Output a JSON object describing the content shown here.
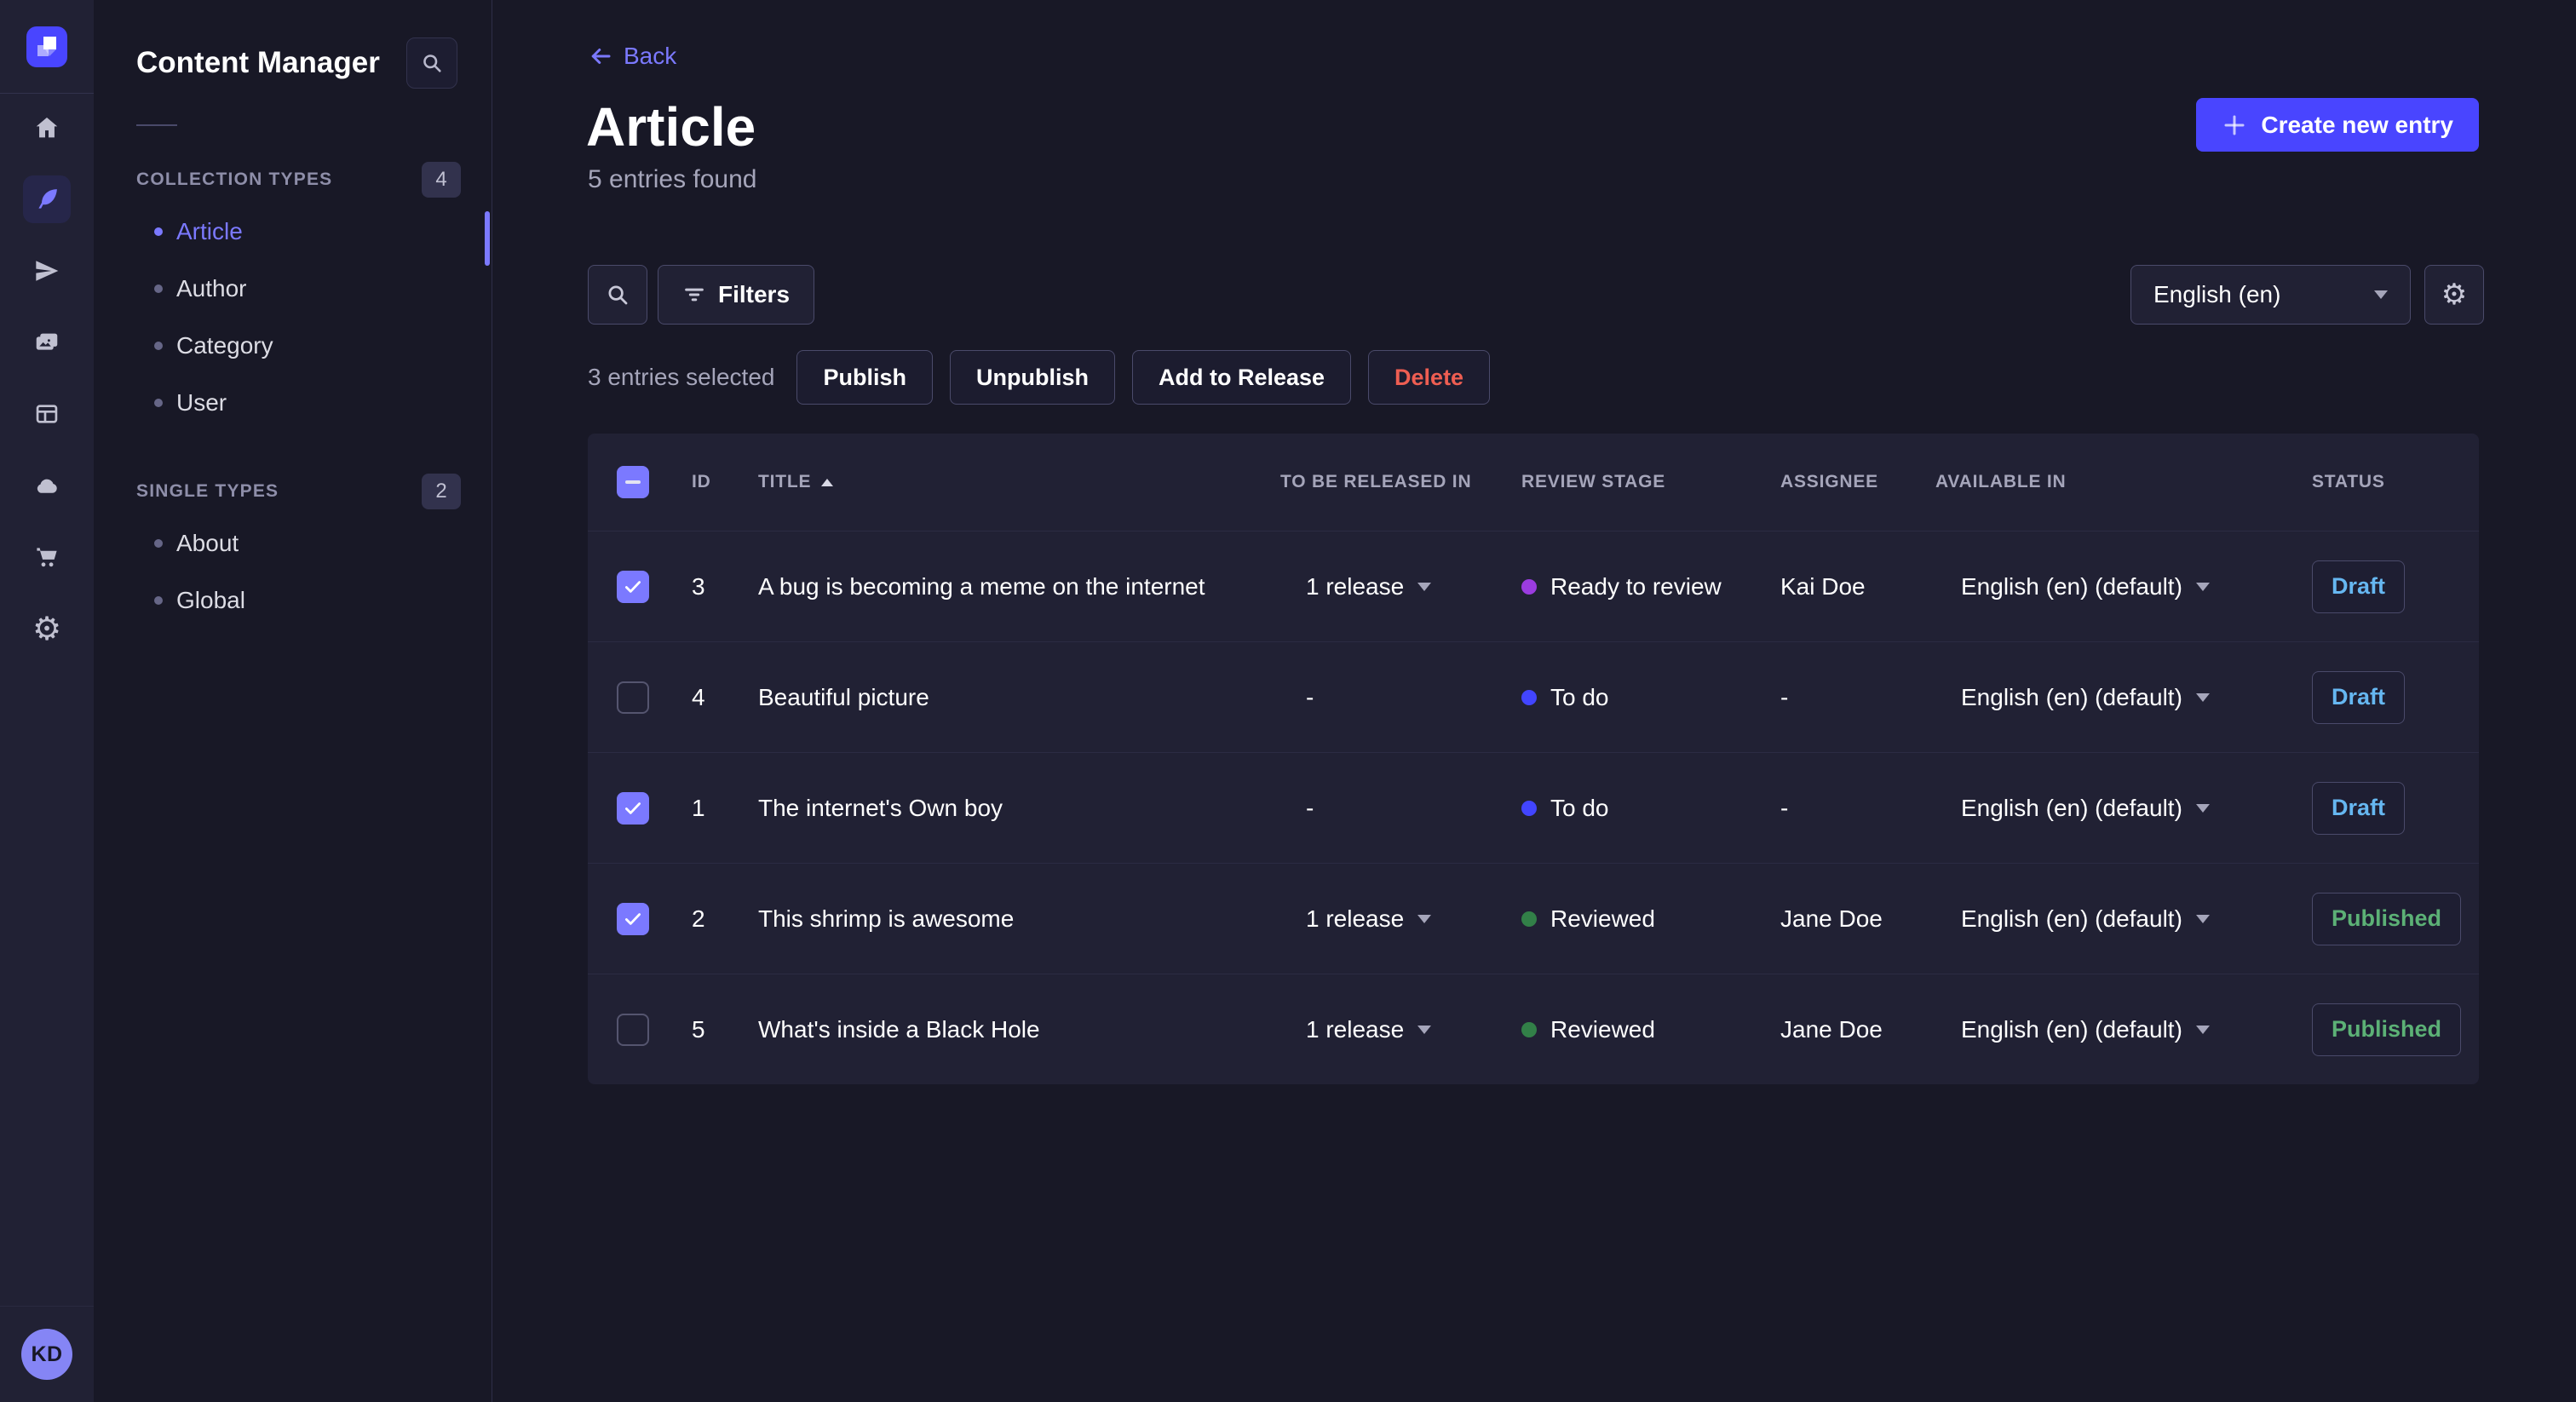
{
  "colors": {
    "accent": "#4945ff",
    "accent_light": "#7b79ff",
    "draft": "#66b7f1",
    "published": "#5cb176",
    "danger": "#ee5e52",
    "stage_todo": "#4245ff",
    "stage_ready": "#9b3ce0",
    "stage_reviewed": "#328048"
  },
  "icon_rail": {
    "logo_icon": "strapi-logo",
    "items": [
      {
        "icon": "home-icon",
        "active": false
      },
      {
        "icon": "feather-icon",
        "active": true
      },
      {
        "icon": "paper-plane-icon",
        "active": false
      },
      {
        "icon": "media-library-icon",
        "active": false
      },
      {
        "icon": "layout-icon",
        "active": false
      },
      {
        "icon": "cloud-icon",
        "active": false
      },
      {
        "icon": "cart-icon",
        "active": false
      },
      {
        "icon": "gear-icon",
        "active": false
      }
    ],
    "avatar_initials": "KD"
  },
  "subnav": {
    "title": "Content Manager",
    "search_icon": "search-icon",
    "collection_types": {
      "label": "COLLECTION TYPES",
      "count": "4",
      "items": [
        {
          "label": "Article",
          "active": true
        },
        {
          "label": "Author",
          "active": false
        },
        {
          "label": "Category",
          "active": false
        },
        {
          "label": "User",
          "active": false
        }
      ]
    },
    "single_types": {
      "label": "SINGLE TYPES",
      "count": "2",
      "items": [
        {
          "label": "About",
          "active": false
        },
        {
          "label": "Global",
          "active": false
        }
      ]
    }
  },
  "header": {
    "back_label": "Back",
    "title": "Article",
    "subtitle": "5 entries found",
    "create_button_label": "Create new entry"
  },
  "toolbar": {
    "filters_label": "Filters",
    "locale_value": "English (en)"
  },
  "bulk_bar": {
    "selected_text": "3 entries selected",
    "publish_label": "Publish",
    "unpublish_label": "Unpublish",
    "add_to_release_label": "Add to Release",
    "delete_label": "Delete"
  },
  "table": {
    "columns": [
      "ID",
      "TITLE",
      "TO BE RELEASED IN",
      "REVIEW STAGE",
      "ASSIGNEE",
      "AVAILABLE IN",
      "STATUS"
    ],
    "sort": {
      "column": "TITLE",
      "direction": "asc"
    },
    "header_checkbox_state": "indeterminate",
    "rows": [
      {
        "checked": true,
        "id": "3",
        "title": "A bug is becoming a meme on the internet",
        "release": "1 release",
        "stage": "Ready to review",
        "stage_key": "ready",
        "assignee": "Kai Doe",
        "locale": "English (en) (default)",
        "status": "Draft"
      },
      {
        "checked": false,
        "id": "4",
        "title": "Beautiful picture",
        "release": "-",
        "stage": "To do",
        "stage_key": "todo",
        "assignee": "-",
        "locale": "English (en) (default)",
        "status": "Draft"
      },
      {
        "checked": true,
        "id": "1",
        "title": "The internet's Own boy",
        "release": "-",
        "stage": "To do",
        "stage_key": "todo",
        "assignee": "-",
        "locale": "English (en) (default)",
        "status": "Draft"
      },
      {
        "checked": true,
        "id": "2",
        "title": "This shrimp is awesome",
        "release": "1 release",
        "stage": "Reviewed",
        "stage_key": "reviewed",
        "assignee": "Jane Doe",
        "locale": "English (en) (default)",
        "status": "Published"
      },
      {
        "checked": false,
        "id": "5",
        "title": "What's inside a Black Hole",
        "release": "1 release",
        "stage": "Reviewed",
        "stage_key": "reviewed",
        "assignee": "Jane Doe",
        "locale": "English (en) (default)",
        "status": "Published"
      }
    ]
  },
  "help": {
    "icon": "question-mark-icon"
  }
}
